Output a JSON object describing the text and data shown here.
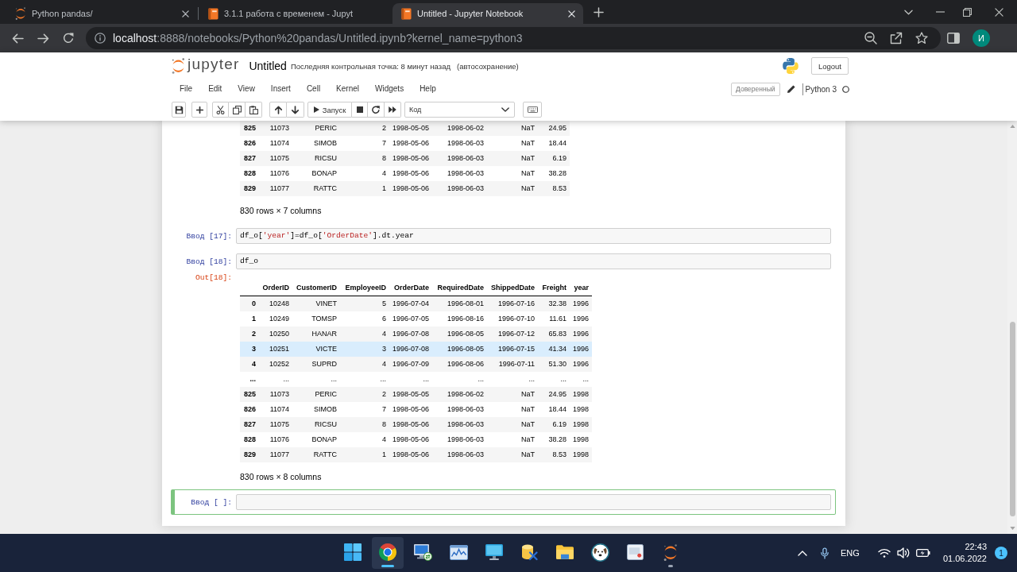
{
  "browser": {
    "tabs": [
      {
        "kind": "tree",
        "title": "Python pandas/",
        "selected": false,
        "closable": true
      },
      {
        "kind": "notebook",
        "title": "3.1.1 работа с временем - Jupyt",
        "selected": false,
        "closable": false
      },
      {
        "kind": "notebook",
        "title": "Untitled - Jupyter Notebook",
        "selected": true,
        "closable": true
      }
    ],
    "url": {
      "host": "localhost",
      "path": ":8888/notebooks/Python%20pandas/Untitled.ipynb?kernel_name=python3"
    },
    "profile_initial": "И"
  },
  "notebook": {
    "logo_text": "jupyter",
    "name": "Untitled",
    "checkpoint": "Последняя контрольная точка: 8 минут назад",
    "autosave": "(автосохранение)",
    "logout": "Logout",
    "menu": [
      "File",
      "Edit",
      "View",
      "Insert",
      "Cell",
      "Kernel",
      "Widgets",
      "Help"
    ],
    "trusted": "Доверенный",
    "kernel": "Python 3",
    "toolbar": {
      "run": "Запуск",
      "cell_type": "Код"
    },
    "cells": [
      {
        "kind": "output",
        "selected": false,
        "table": {
          "rows": [
            {
              "index": "825",
              "values": [
                "11073",
                "PERIC",
                "2",
                "1998-05-05",
                "1998-06-02",
                "NaT",
                "24.95"
              ],
              "highlighted": false
            },
            {
              "index": "826",
              "values": [
                "11074",
                "SIMOB",
                "7",
                "1998-05-06",
                "1998-06-03",
                "NaT",
                "18.44"
              ],
              "highlighted": false
            },
            {
              "index": "827",
              "values": [
                "11075",
                "RICSU",
                "8",
                "1998-05-06",
                "1998-06-03",
                "NaT",
                "6.19"
              ],
              "highlighted": false
            },
            {
              "index": "828",
              "values": [
                "11076",
                "BONAP",
                "4",
                "1998-05-06",
                "1998-06-03",
                "NaT",
                "38.28"
              ],
              "highlighted": false
            },
            {
              "index": "829",
              "values": [
                "11077",
                "RATTC",
                "1",
                "1998-05-06",
                "1998-06-03",
                "NaT",
                "8.53"
              ],
              "highlighted": false
            }
          ]
        },
        "shape": "830 rows × 7 columns"
      },
      {
        "kind": "code",
        "prompt": "Ввод [17]:",
        "selected": false,
        "code": [
          {
            "kind": "name",
            "text": "df_o["
          },
          {
            "kind": "string",
            "text": "'year'"
          },
          {
            "kind": "name",
            "text": "]=df_o["
          },
          {
            "kind": "string",
            "text": "'OrderDate'"
          },
          {
            "kind": "name",
            "text": "].dt.year"
          }
        ]
      },
      {
        "kind": "code",
        "prompt": "Ввод [18]:",
        "selected": false,
        "code": [
          {
            "kind": "name",
            "text": "df_o"
          }
        ],
        "output": {
          "prompt": "Out[18]:",
          "table": {
            "columns": [
              "OrderID",
              "CustomerID",
              "EmployeeID",
              "OrderDate",
              "RequiredDate",
              "ShippedDate",
              "Freight",
              "year"
            ],
            "rows": [
              {
                "index": "0",
                "values": [
                  "10248",
                  "VINET",
                  "5",
                  "1996-07-04",
                  "1996-08-01",
                  "1996-07-16",
                  "32.38",
                  "1996"
                ],
                "highlighted": false
              },
              {
                "index": "1",
                "values": [
                  "10249",
                  "TOMSP",
                  "6",
                  "1996-07-05",
                  "1996-08-16",
                  "1996-07-10",
                  "11.61",
                  "1996"
                ],
                "highlighted": false
              },
              {
                "index": "2",
                "values": [
                  "10250",
                  "HANAR",
                  "4",
                  "1996-07-08",
                  "1996-08-05",
                  "1996-07-12",
                  "65.83",
                  "1996"
                ],
                "highlighted": false
              },
              {
                "index": "3",
                "values": [
                  "10251",
                  "VICTE",
                  "3",
                  "1996-07-08",
                  "1996-08-05",
                  "1996-07-15",
                  "41.34",
                  "1996"
                ],
                "highlighted": true
              },
              {
                "index": "4",
                "values": [
                  "10252",
                  "SUPRD",
                  "4",
                  "1996-07-09",
                  "1996-08-06",
                  "1996-07-11",
                  "51.30",
                  "1996"
                ],
                "highlighted": false
              },
              {
                "index": "...",
                "values": [
                  "...",
                  "...",
                  "...",
                  "...",
                  "...",
                  "...",
                  "...",
                  "..."
                ],
                "highlighted": false
              },
              {
                "index": "825",
                "values": [
                  "11073",
                  "PERIC",
                  "2",
                  "1998-05-05",
                  "1998-06-02",
                  "NaT",
                  "24.95",
                  "1998"
                ],
                "highlighted": false
              },
              {
                "index": "826",
                "values": [
                  "11074",
                  "SIMOB",
                  "7",
                  "1998-05-06",
                  "1998-06-03",
                  "NaT",
                  "18.44",
                  "1998"
                ],
                "highlighted": false
              },
              {
                "index": "827",
                "values": [
                  "11075",
                  "RICSU",
                  "8",
                  "1998-05-06",
                  "1998-06-03",
                  "NaT",
                  "6.19",
                  "1998"
                ],
                "highlighted": false
              },
              {
                "index": "828",
                "values": [
                  "11076",
                  "BONAP",
                  "4",
                  "1998-05-06",
                  "1998-06-03",
                  "NaT",
                  "38.28",
                  "1998"
                ],
                "highlighted": false
              },
              {
                "index": "829",
                "values": [
                  "11077",
                  "RATTC",
                  "1",
                  "1998-05-06",
                  "1998-06-03",
                  "NaT",
                  "8.53",
                  "1998"
                ],
                "highlighted": false
              }
            ]
          },
          "shape": "830 rows × 8 columns"
        }
      },
      {
        "kind": "code",
        "prompt": "Ввод [ ]:",
        "selected": true
      }
    ]
  },
  "taskbar": {
    "apps": [
      {
        "kind": "start",
        "selected": false,
        "running": false
      },
      {
        "kind": "browser",
        "selected": true,
        "running": true
      },
      {
        "kind": "remote",
        "selected": false,
        "running": false
      },
      {
        "kind": "chart",
        "selected": false,
        "running": false
      },
      {
        "kind": "display",
        "selected": false,
        "running": false
      },
      {
        "kind": "tools",
        "selected": false,
        "running": false
      },
      {
        "kind": "folder",
        "selected": false,
        "running": false
      },
      {
        "kind": "dog",
        "selected": false,
        "running": false
      },
      {
        "kind": "window",
        "selected": false,
        "running": false
      },
      {
        "kind": "jupyter",
        "selected": false,
        "running": true
      }
    ],
    "language": "ENG",
    "time": "22:43",
    "date": "01.06.2022",
    "notifications": "1"
  }
}
